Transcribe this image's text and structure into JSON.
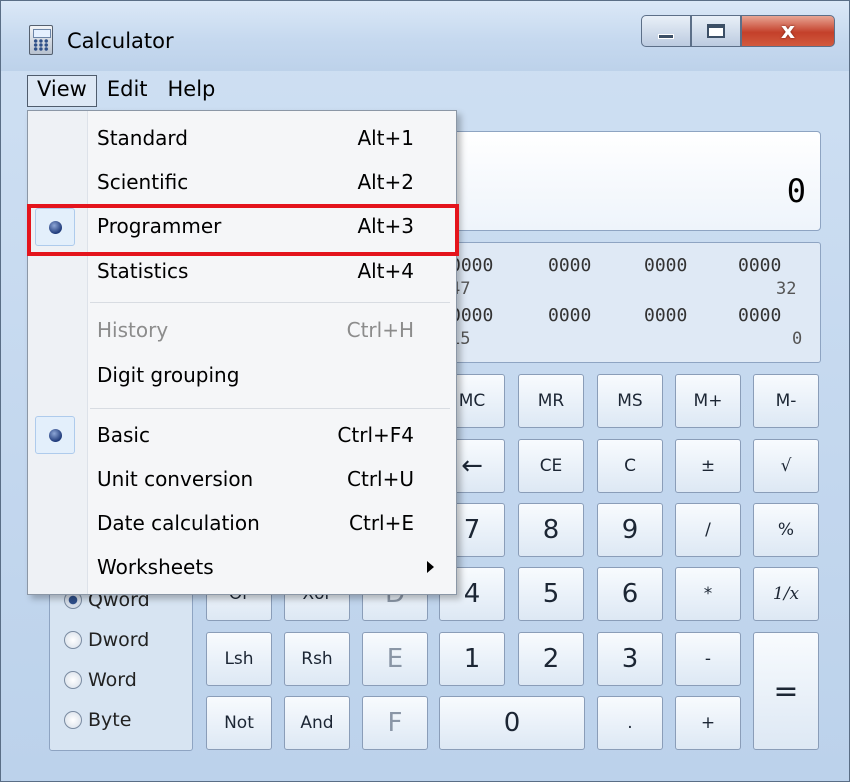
{
  "window": {
    "title": "Calculator",
    "close_glyph": "x"
  },
  "menubar": {
    "items": [
      "View",
      "Edit",
      "Help"
    ]
  },
  "display": {
    "value": "0"
  },
  "bits": {
    "row1": [
      "0000",
      "0000",
      "0000",
      "0000"
    ],
    "row1_pos": [
      "47",
      "32"
    ],
    "row2": [
      "0000",
      "0000",
      "0000",
      "0000"
    ],
    "row2_pos": [
      "15",
      "0"
    ]
  },
  "memory_buttons": [
    "MC",
    "MR",
    "MS",
    "M+",
    "M-"
  ],
  "row2_buttons": [
    "←",
    "CE",
    "C",
    "±",
    "√"
  ],
  "row3_buttons": [
    "7",
    "8",
    "9",
    "/",
    "%"
  ],
  "row4_buttons": [
    "Or",
    "Xor",
    "D",
    "4",
    "5",
    "6",
    "*",
    "1/x"
  ],
  "row5_buttons": [
    "Lsh",
    "Rsh",
    "E",
    "1",
    "2",
    "3",
    "-"
  ],
  "row6_buttons": [
    "Not",
    "And",
    "F",
    "0",
    ".",
    "+"
  ],
  "equals": "=",
  "word_sizes": [
    "Qword",
    "Dword",
    "Word",
    "Byte"
  ],
  "view_menu": {
    "items": [
      {
        "label": "Standard",
        "shortcut": "Alt+1"
      },
      {
        "label": "Scientific",
        "shortcut": "Alt+2"
      },
      {
        "label": "Programmer",
        "shortcut": "Alt+3",
        "selected": true
      },
      {
        "label": "Statistics",
        "shortcut": "Alt+4"
      },
      {
        "label": "History",
        "shortcut": "Ctrl+H",
        "disabled": true
      },
      {
        "label": "Digit grouping",
        "shortcut": ""
      },
      {
        "label": "Basic",
        "shortcut": "Ctrl+F4",
        "selected": true
      },
      {
        "label": "Unit conversion",
        "shortcut": "Ctrl+U"
      },
      {
        "label": "Date calculation",
        "shortcut": "Ctrl+E"
      },
      {
        "label": "Worksheets",
        "shortcut": ""
      }
    ]
  },
  "colors": {
    "highlight": "#e4141c",
    "accent": "#2f4f8a"
  }
}
